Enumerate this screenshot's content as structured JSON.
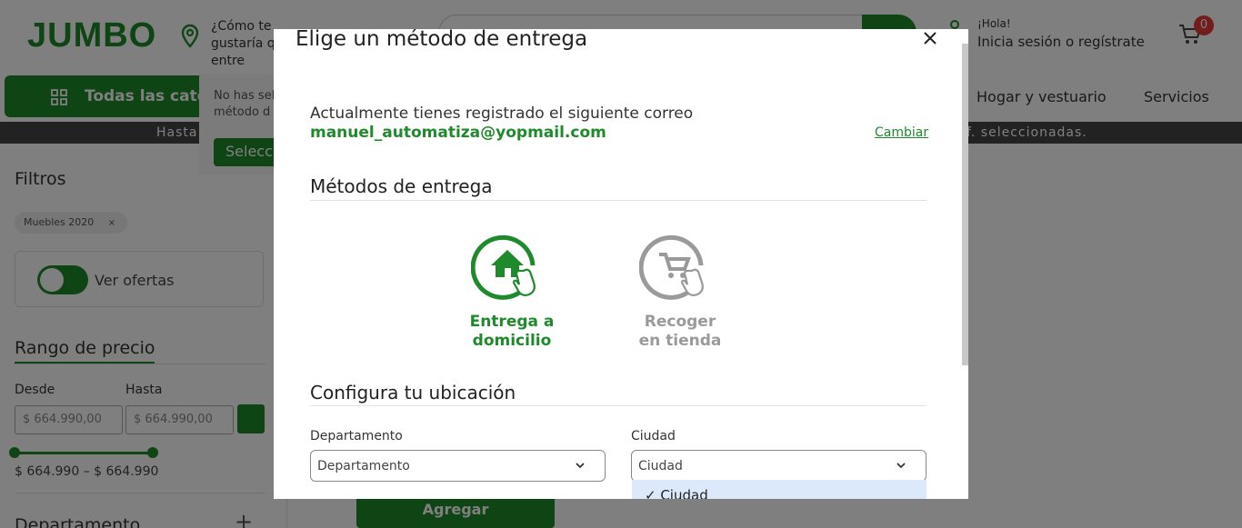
{
  "header": {
    "logo": "JUMBO",
    "location_text": "¿Cómo te gustaría que entre",
    "greeting": "¡Hola!",
    "login": "Inicia sesión o regístrate",
    "cart_count": "0"
  },
  "nav": {
    "all_categories": "Todas las categ",
    "items": [
      "Hogar y vestuario",
      "Servicios"
    ]
  },
  "promo": {
    "left": "Hasta",
    "right": "f. seleccionadas."
  },
  "category_dropdown": {
    "text": "No has sel método d",
    "button": "Selecc"
  },
  "sidebar": {
    "filters_title": "Filtros",
    "chip": "Muebles 2020",
    "chip_close": "×",
    "offers_label": "Ver ofertas",
    "price_title": "Rango de precio",
    "from_label": "Desde",
    "to_label": "Hasta",
    "from_placeholder": "$ 664.990,00",
    "to_placeholder": "$ 664.990,00",
    "range_value": "$ 664.990 – $ 664.990",
    "department_title": "Departamento",
    "department_toggle": "+"
  },
  "add_button": "Agregar",
  "modal": {
    "title": "Elige un método de entrega",
    "current_email_label": "Actualmente tienes registrado el siguiente correo",
    "email": "manuel_automatiza@yopmail.com",
    "change_link": "Cambiar",
    "methods_title": "Métodos de entrega",
    "methods": [
      {
        "label": "Entrega a\ndomicilio",
        "active": true
      },
      {
        "label": "Recoger\nen tienda",
        "active": false
      }
    ],
    "location_title": "Configura tu ubicación",
    "department_label": "Departamento",
    "department_value": "Departamento",
    "city_label": "Ciudad",
    "city_value": "Ciudad",
    "city_option": "✓ Ciudad"
  },
  "colors": {
    "brand": "#1f8a2b",
    "inactive": "#9a9a9a",
    "badge": "#e5383b"
  }
}
